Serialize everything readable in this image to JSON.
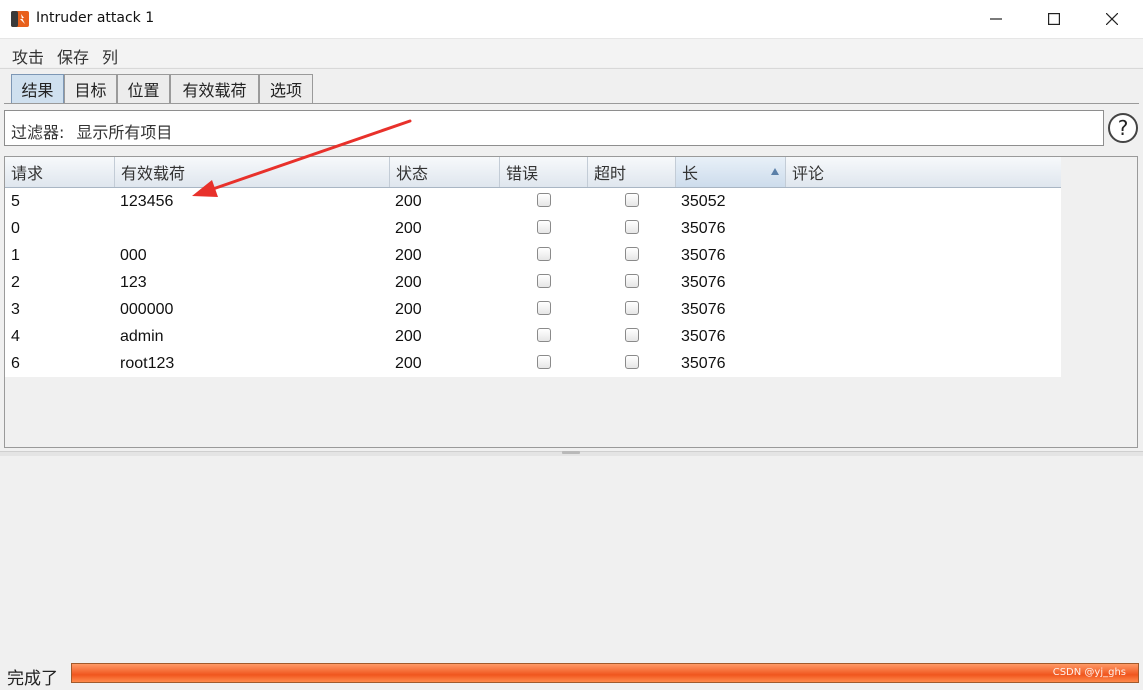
{
  "window": {
    "title": "Intruder attack 1"
  },
  "menu": [
    "攻击",
    "保存",
    "列"
  ],
  "tabs": [
    "结果",
    "目标",
    "位置",
    "有效载荷",
    "选项"
  ],
  "active_tab": "结果",
  "filter": {
    "label": "过滤器:",
    "value": "显示所有项目"
  },
  "help": {
    "label": "?"
  },
  "table": {
    "columns": [
      "请求",
      "有效载荷",
      "状态",
      "错误",
      "超时",
      "长",
      "评论"
    ],
    "sorted_column": "长",
    "rows": [
      {
        "request": "5",
        "payload": "123456",
        "status": "200",
        "error": false,
        "timeout": false,
        "length": "35052",
        "comment": ""
      },
      {
        "request": "0",
        "payload": "",
        "status": "200",
        "error": false,
        "timeout": false,
        "length": "35076",
        "comment": ""
      },
      {
        "request": "1",
        "payload": "000",
        "status": "200",
        "error": false,
        "timeout": false,
        "length": "35076",
        "comment": ""
      },
      {
        "request": "2",
        "payload": "123",
        "status": "200",
        "error": false,
        "timeout": false,
        "length": "35076",
        "comment": ""
      },
      {
        "request": "3",
        "payload": "000000",
        "status": "200",
        "error": false,
        "timeout": false,
        "length": "35076",
        "comment": ""
      },
      {
        "request": "4",
        "payload": "admin",
        "status": "200",
        "error": false,
        "timeout": false,
        "length": "35076",
        "comment": ""
      },
      {
        "request": "6",
        "payload": "root123",
        "status": "200",
        "error": false,
        "timeout": false,
        "length": "35076",
        "comment": ""
      }
    ]
  },
  "status": {
    "text": "完成了",
    "progress": 1.0,
    "watermark": "CSDN @yj_ghs"
  },
  "colors": {
    "accent_tab": "#cfe0ef",
    "progress": "#f0561e",
    "annotation_arrow": "#e8312b",
    "app_icon": "#e8601c"
  }
}
